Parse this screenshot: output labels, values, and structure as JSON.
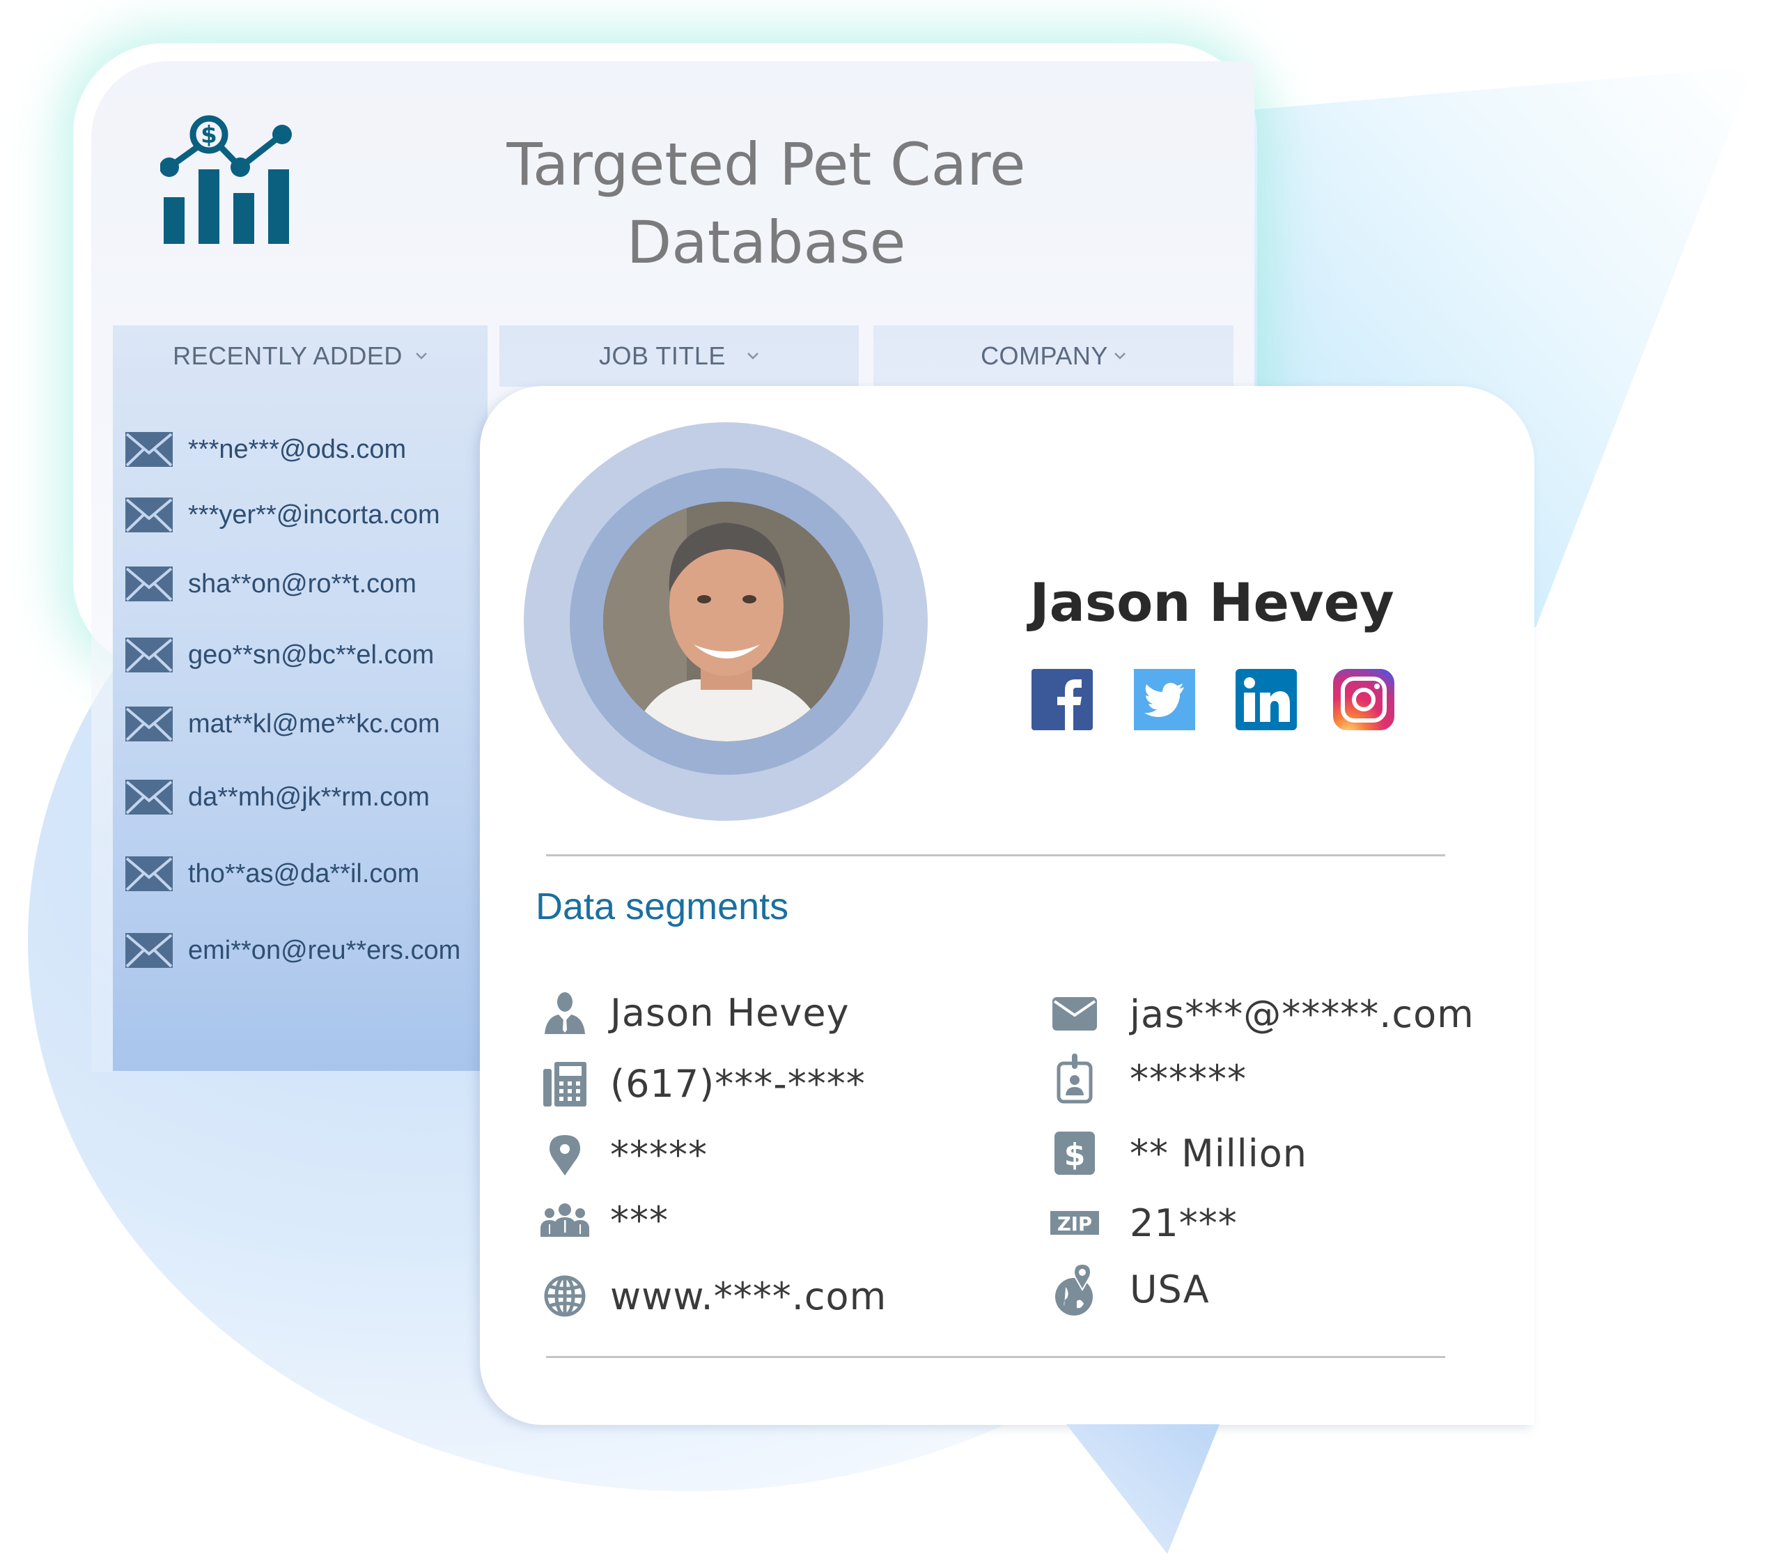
{
  "header": {
    "title_line1": "Targeted Pet Care",
    "title_line2": "Database",
    "logo_icon": "finance-chart-icon"
  },
  "tabs": [
    {
      "label": "RECENTLY ADDED",
      "icon": "chevron-down-icon"
    },
    {
      "label": "JOB TITLE",
      "icon": "chevron-down-icon"
    },
    {
      "label": "COMPANY",
      "icon": "chevron-down-icon"
    }
  ],
  "recent_emails": [
    "***ne***@ods.com",
    "***yer**@incorta.com",
    "sha**on@ro**t.com",
    "geo**sn@bc**el.com",
    "mat**kl@me**kc.com",
    "da**mh@jk**rm.com",
    "tho**as@da**il.com",
    "emi**on@reu**ers.com"
  ],
  "profile": {
    "name": "Jason Hevey",
    "social": [
      {
        "name": "Facebook",
        "icon": "facebook-icon",
        "color": "#3b5998"
      },
      {
        "name": "Twitter",
        "icon": "twitter-icon",
        "color": "#55acee"
      },
      {
        "name": "LinkedIn",
        "icon": "linkedin-icon",
        "color": "#0077b5"
      },
      {
        "name": "Instagram",
        "icon": "instagram-icon",
        "color": "#c13584"
      }
    ]
  },
  "segments": {
    "title": "Data segments",
    "left": [
      {
        "icon": "person-icon",
        "value": "Jason Hevey"
      },
      {
        "icon": "phone-icon",
        "value": "(617)***-****"
      },
      {
        "icon": "location-pin-icon",
        "value": "*****"
      },
      {
        "icon": "employees-icon",
        "value": "***"
      },
      {
        "icon": "globe-icon",
        "value": "www.****.com"
      }
    ],
    "right": [
      {
        "icon": "envelope-icon",
        "value": "jas***@*****.com"
      },
      {
        "icon": "id-badge-icon",
        "value": "******"
      },
      {
        "icon": "dollar-icon",
        "value": "** Million"
      },
      {
        "icon": "zip-icon",
        "value": "21***"
      },
      {
        "icon": "globe-pin-icon",
        "value": "USA"
      }
    ]
  },
  "colors": {
    "accent": "#1a6fa0",
    "logo": "#0b6080",
    "icon_gray": "#7b8d99",
    "email_text": "#2f4e72"
  }
}
